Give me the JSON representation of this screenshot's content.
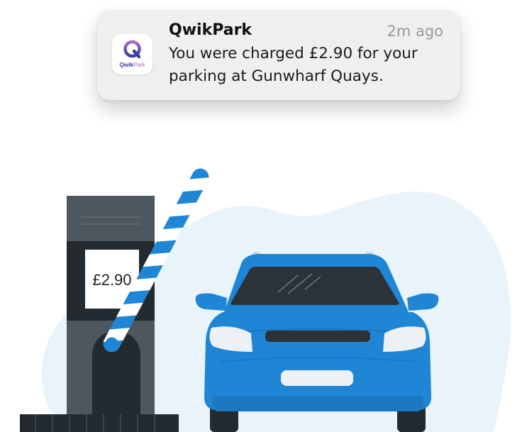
{
  "notification": {
    "app_name": "QwikPark",
    "time": "2m ago",
    "message": "You were charged £2.90 for your parking at Gunwharf Quays.",
    "icon": {
      "name": "qwikpark-logo-icon",
      "wordmark_part1": "Qwik",
      "wordmark_part2": "Park",
      "colors": {
        "q_gradient_top": "#a86cc8",
        "q_gradient_bottom": "#3a3f9e"
      }
    }
  },
  "parking_scene": {
    "ticket_machine": {
      "display_price": "£2.90"
    },
    "barrier": {
      "state": "raised"
    },
    "colors": {
      "car_body": "#1f86d6",
      "machine_body": "#4d575f",
      "barrier_stripes": [
        "#1f86d6",
        "#ffffff"
      ],
      "background_blob": "#e8f3fa"
    }
  }
}
